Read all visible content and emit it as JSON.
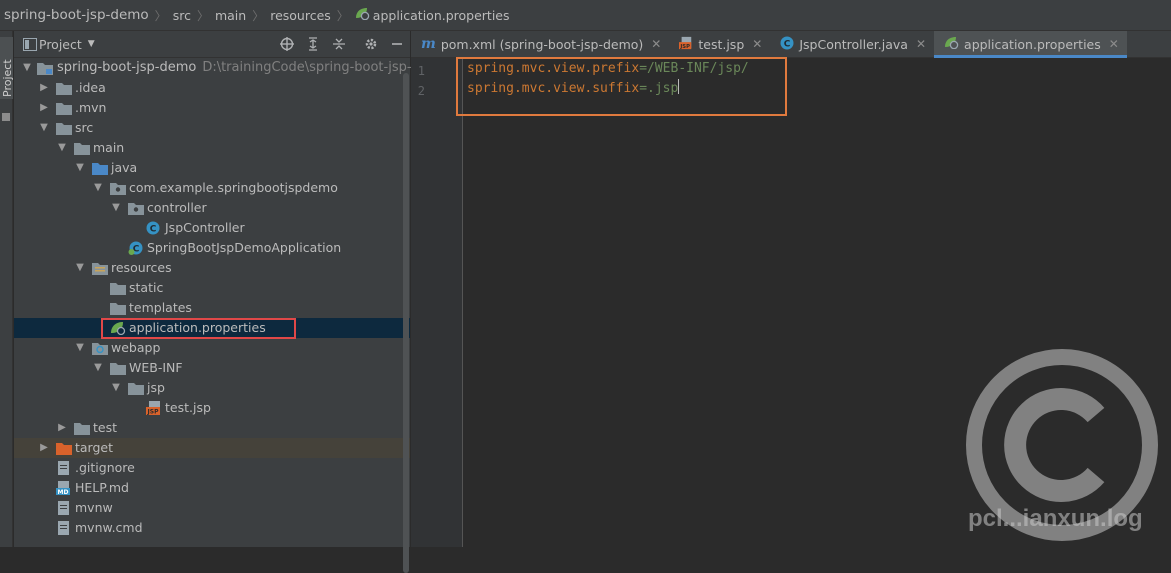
{
  "breadcrumb": {
    "items": [
      "spring-boot-jsp-demo",
      "src",
      "main",
      "resources",
      "application.properties"
    ]
  },
  "toolstrip": {
    "label": "Project"
  },
  "project_panel": {
    "title": "Project",
    "tools": [
      "crosshair-icon",
      "expand-all-icon",
      "collapse-all-icon",
      "gear-icon",
      "minimize-icon"
    ],
    "tree": [
      {
        "label": "spring-boot-jsp-demo",
        "path": "D:\\trainingCode\\spring-boot-jsp-dem",
        "icon": "module-folder-icon"
      },
      {
        "label": ".idea",
        "icon": "folder-icon"
      },
      {
        "label": ".mvn",
        "icon": "folder-icon"
      },
      {
        "label": "src",
        "icon": "folder-icon"
      },
      {
        "label": "main",
        "icon": "folder-icon"
      },
      {
        "label": "java",
        "icon": "source-folder-icon"
      },
      {
        "label": "com.example.springbootjspdemo",
        "icon": "package-icon"
      },
      {
        "label": "controller",
        "icon": "package-icon"
      },
      {
        "label": "JspController",
        "icon": "class-icon"
      },
      {
        "label": "SpringBootJspDemoApplication",
        "icon": "spring-class-icon"
      },
      {
        "label": "resources",
        "icon": "resources-folder-icon"
      },
      {
        "label": "static",
        "icon": "folder-icon"
      },
      {
        "label": "templates",
        "icon": "folder-icon"
      },
      {
        "label": "application.properties",
        "icon": "spring-properties-icon"
      },
      {
        "label": "webapp",
        "icon": "web-folder-icon"
      },
      {
        "label": "WEB-INF",
        "icon": "folder-icon"
      },
      {
        "label": "jsp",
        "icon": "folder-icon"
      },
      {
        "label": "test.jsp",
        "icon": "jsp-file-icon"
      },
      {
        "label": "test",
        "icon": "folder-icon"
      },
      {
        "label": "target",
        "icon": "excluded-folder-icon"
      },
      {
        "label": ".gitignore",
        "icon": "text-file-icon"
      },
      {
        "label": "HELP.md",
        "icon": "markdown-file-icon"
      },
      {
        "label": "mvnw",
        "icon": "text-file-icon"
      },
      {
        "label": "mvnw.cmd",
        "icon": "text-file-icon"
      }
    ]
  },
  "tabs": [
    {
      "label": "pom.xml (spring-boot-jsp-demo)",
      "icon": "maven-icon"
    },
    {
      "label": "test.jsp",
      "icon": "jsp-file-icon"
    },
    {
      "label": "JspController.java",
      "icon": "class-icon"
    },
    {
      "label": "application.properties",
      "icon": "spring-properties-icon"
    }
  ],
  "editor": {
    "line_numbers": [
      "1",
      "2"
    ],
    "lines": [
      {
        "key": "spring.mvc.view.prefix",
        "sep": "=",
        "value": "/WEB-INF/jsp/"
      },
      {
        "key": "spring.mvc.view.suffix",
        "sep": "=",
        "value": ".jsp"
      }
    ]
  },
  "watermark": {
    "text": "pcl...ianxun.log"
  },
  "colors": {
    "highlight_box_tree": "#e04848",
    "highlight_box_code": "#e07a3e",
    "property_key": "#cc7832",
    "property_value": "#6a8759",
    "selection": "#0d293e",
    "active_tab_underline": "#4a88c7"
  }
}
